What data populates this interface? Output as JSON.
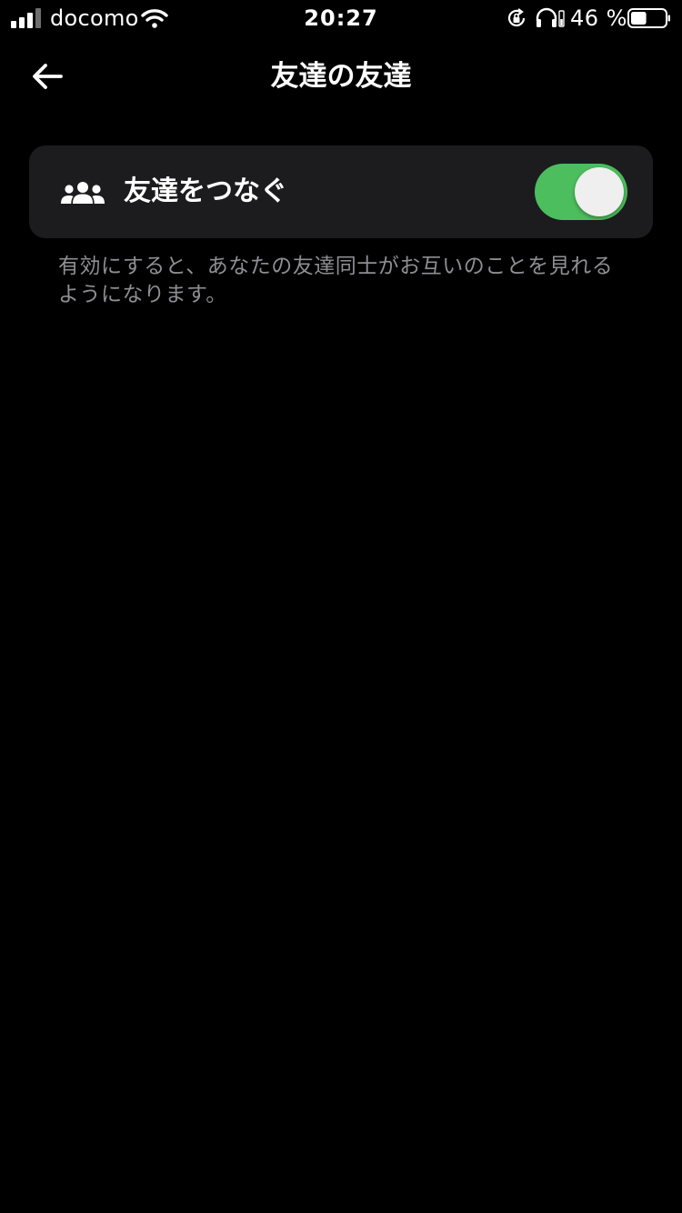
{
  "status_bar": {
    "carrier": "docomo",
    "time": "20:27",
    "battery_percent_text": "46 %",
    "battery_level": 0.46,
    "signal_bars_active": 3,
    "signal_bars_total": 4,
    "icons": [
      "signal-icon",
      "wifi-icon",
      "rotation-lock-icon",
      "headphones-icon",
      "battery-icon"
    ]
  },
  "header": {
    "title": "友達の友達",
    "back_icon": "arrow-left-icon"
  },
  "setting": {
    "icon": "people-icon",
    "label": "友達をつなぐ",
    "toggle_on": true
  },
  "description": "有効にすると、あなたの友達同士がお互いのことを見れるようになります。",
  "colors": {
    "background": "#000000",
    "card": "#1c1c1e",
    "toggle_on": "#4cbe5d",
    "secondary_text": "#8e8e93"
  }
}
